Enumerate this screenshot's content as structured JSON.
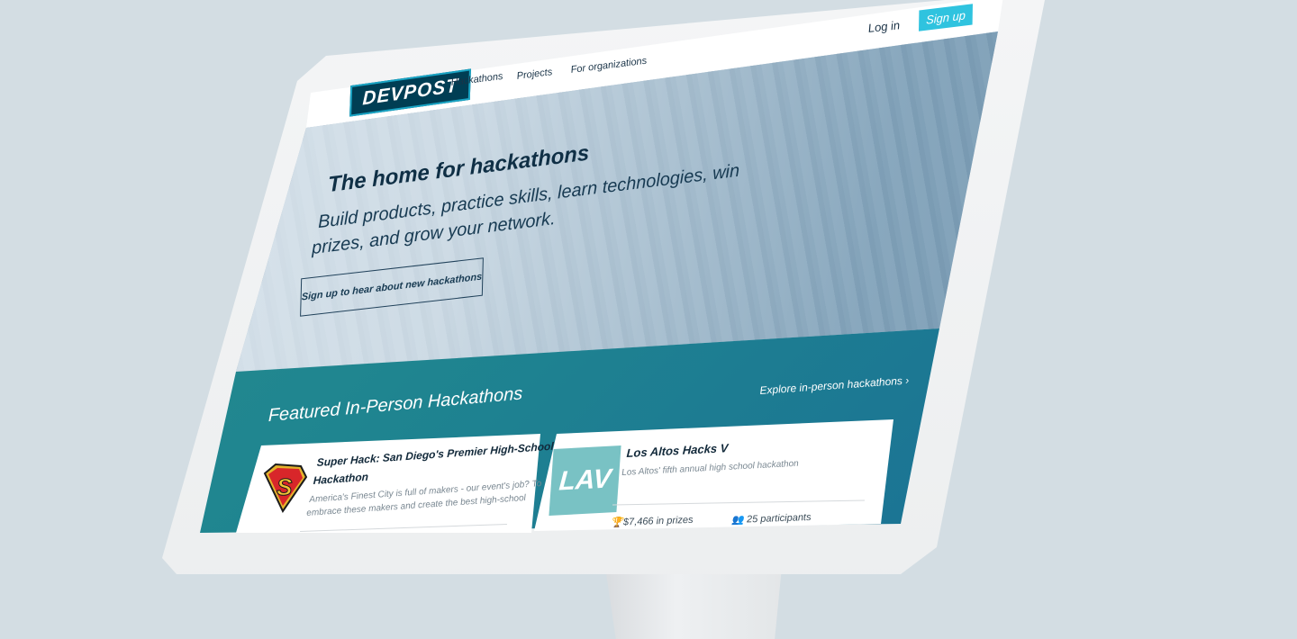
{
  "header": {
    "logo_text": "DEVPOST",
    "nav": [
      "Hackathons",
      "Projects",
      "For organizations"
    ],
    "login_label": "Log in",
    "signup_label": "Sign up"
  },
  "hero": {
    "title": "The home for hackathons",
    "subtitle_line1": "Build products, practice skills, learn technologies, win",
    "subtitle_line2": "prizes, and grow your network.",
    "cta_label": "Sign up to hear about new hackathons"
  },
  "featured": {
    "title": "Featured In-Person Hackathons",
    "explore_label": "Explore in-person hackathons",
    "explore_icon": "chevron-right-icon",
    "cards": [
      {
        "title_line1": "Super Hack: San Diego's Premier High-School",
        "title_line2": "Hackathon",
        "desc_line1": "America's Finest City is full of makers - our event's job? To",
        "desc_line2": "embrace these makers and create the best high-school",
        "logo_icon": "superhero-shield-icon"
      },
      {
        "title": "Los Altos Hacks V",
        "desc": "Los Altos' fifth annual high school hackathon",
        "logo_text": "LAV",
        "prizes": "$7,466 in prizes",
        "participants": "25 participants",
        "prize_icon": "trophy-icon",
        "participants_icon": "people-icon"
      }
    ]
  },
  "colors": {
    "brand_dark": "#003e54",
    "accent": "#2fc3df",
    "teal_band": "#1f8590",
    "background": "#d3dde3"
  }
}
